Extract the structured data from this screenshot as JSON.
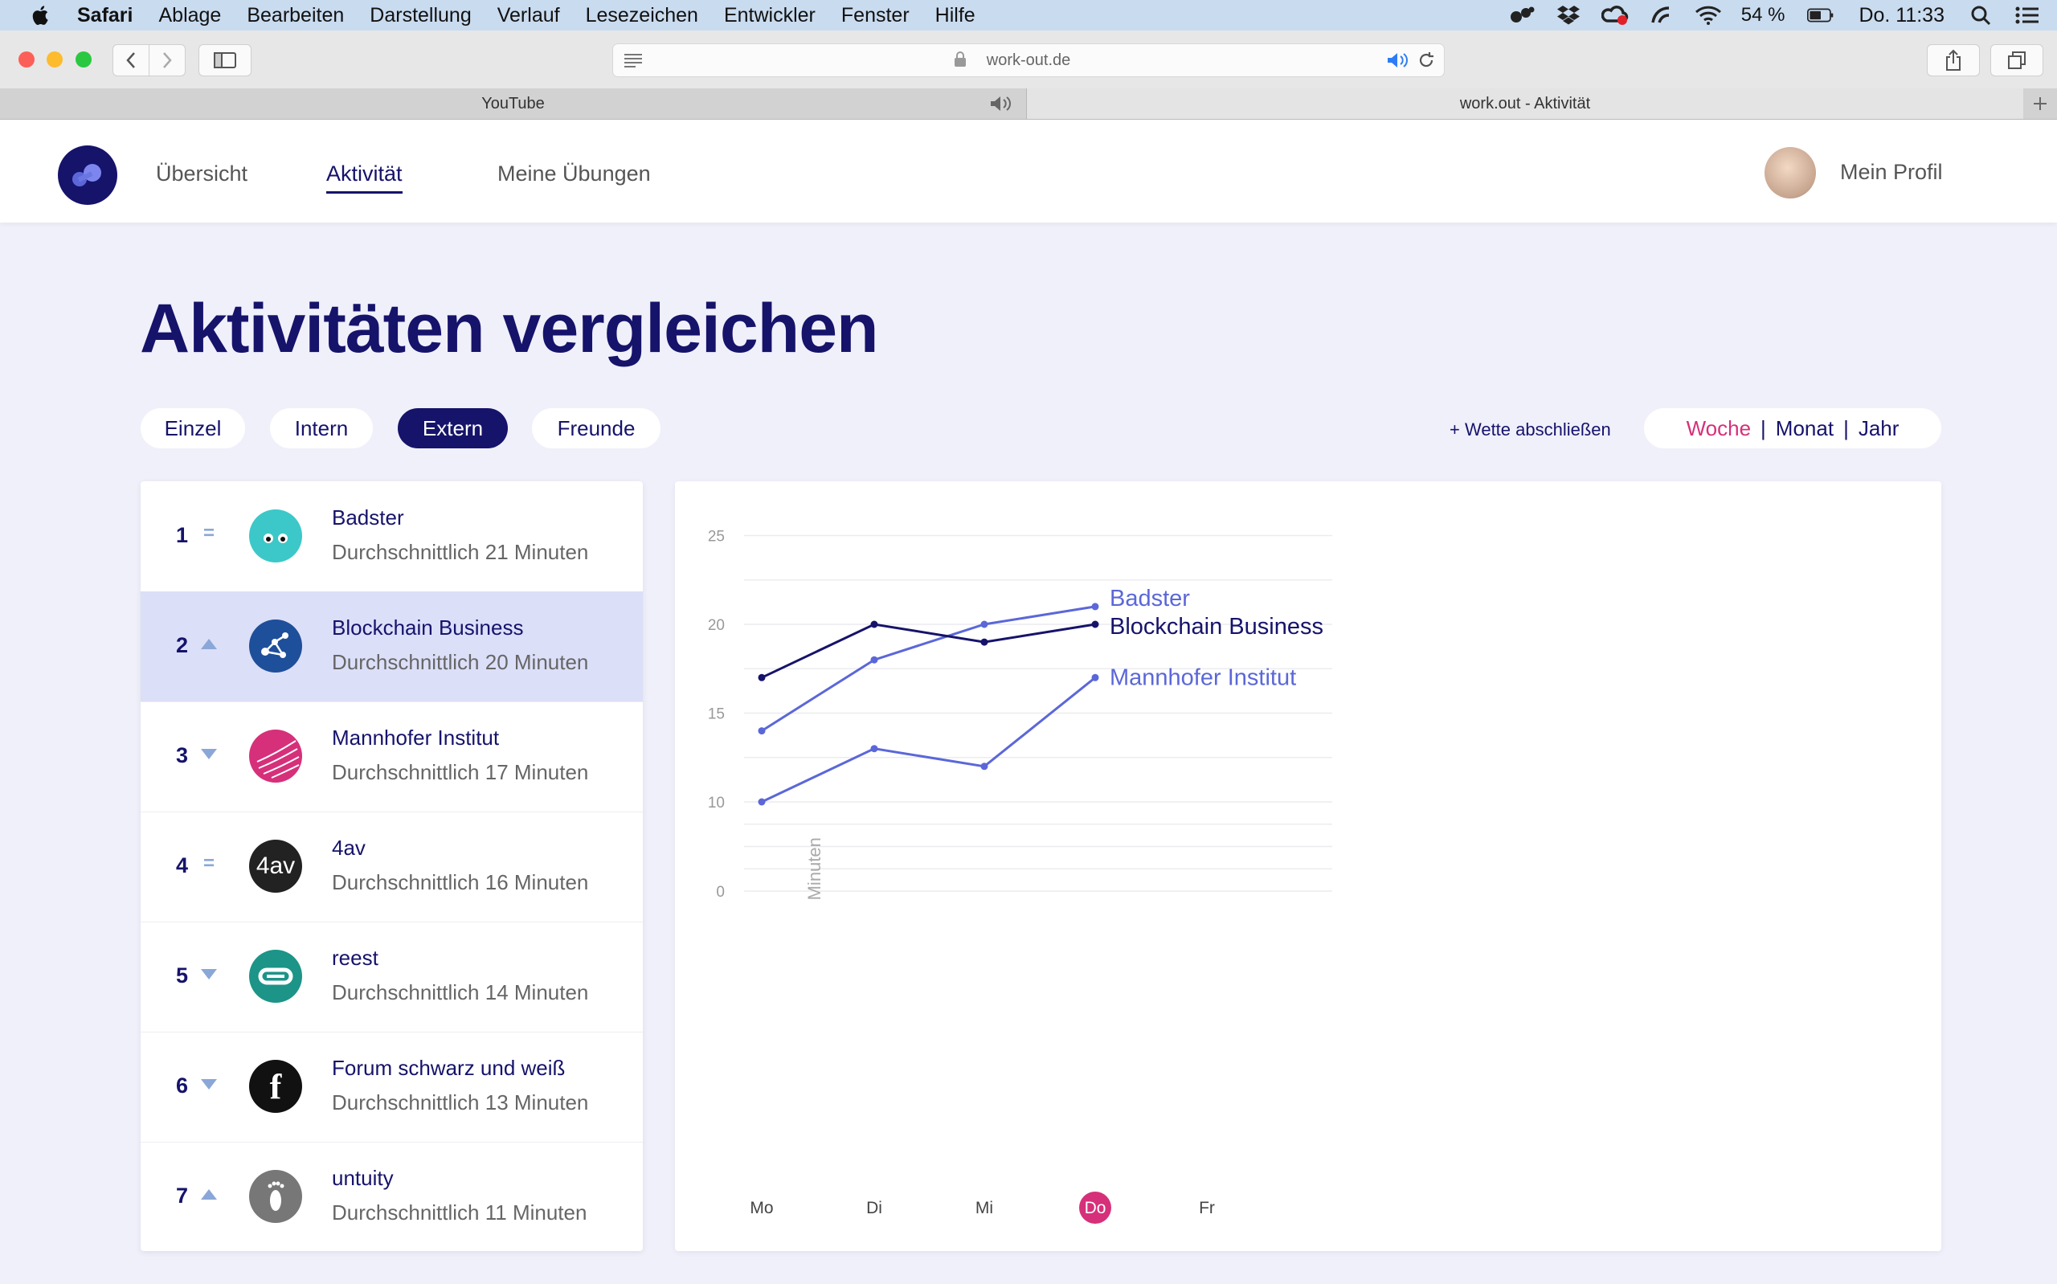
{
  "menubar": {
    "app": "Safari",
    "items": [
      "Ablage",
      "Bearbeiten",
      "Darstellung",
      "Verlauf",
      "Lesezeichen",
      "Entwickler",
      "Fenster",
      "Hilfe"
    ],
    "battery": "54 %",
    "clock": "Do. 11:33"
  },
  "browser": {
    "url": "work-out.de",
    "tabs": [
      "YouTube",
      "work.out - Aktivität"
    ]
  },
  "header": {
    "nav": [
      "Übersicht",
      "Aktivität",
      "Meine Übungen"
    ],
    "profile": "Mein Profil"
  },
  "page": {
    "title": "Aktivitäten vergleichen",
    "filters": [
      "Einzel",
      "Intern",
      "Extern",
      "Freunde"
    ],
    "wette": "+ Wette abschließen",
    "periods": [
      "Woche",
      "Monat",
      "Jahr"
    ],
    "period_separator": "|"
  },
  "ranking": [
    {
      "rank": "1",
      "trend": "same",
      "trend_symbol": "=",
      "name": "Badster",
      "avg": "Durchschnittlich 21 Minuten",
      "logo_color": "#3cc8c8",
      "logo": "eyes-logo-icon"
    },
    {
      "rank": "2",
      "trend": "up",
      "name": "Blockchain Business",
      "avg": "Durchschnittlich 20 Minuten",
      "logo_color": "#1e4f9a",
      "logo": "network-logo-icon"
    },
    {
      "rank": "3",
      "trend": "down",
      "name": "Mannhofer Institut",
      "avg": "Durchschnittlich 17 Minuten",
      "logo_color": "#d6307a",
      "logo": "sphere-logo-icon"
    },
    {
      "rank": "4",
      "trend": "same",
      "trend_symbol": "=",
      "name": "4av",
      "avg": "Durchschnittlich 16 Minuten",
      "logo_color": "#222222",
      "logo": "4av-logo-icon",
      "logo_text": "4av"
    },
    {
      "rank": "5",
      "trend": "down",
      "name": "reest",
      "avg": "Durchschnittlich 14 Minuten",
      "logo_color": "#1c9488",
      "logo": "infinity-logo-icon"
    },
    {
      "rank": "6",
      "trend": "down",
      "name": "Forum schwarz und weiß",
      "avg": "Durchschnittlich 13 Minuten",
      "logo_color": "#111111",
      "logo": "f-logo-icon",
      "logo_text": "f"
    },
    {
      "rank": "7",
      "trend": "up",
      "name": "untuity",
      "avg": "Durchschnittlich 11 Minuten",
      "logo_color": "#777777",
      "logo": "footprint-logo-icon"
    }
  ],
  "chart_data": {
    "type": "line",
    "categories": [
      "Mo",
      "Di",
      "Mi",
      "Do",
      "Fr"
    ],
    "highlight_category": "Do",
    "ylabel": "Minuten",
    "yticks": [
      0,
      10,
      15,
      20,
      25
    ],
    "ylim": [
      0,
      25
    ],
    "grid": true,
    "series": [
      {
        "name": "Badster",
        "values": [
          14,
          18,
          20,
          21,
          null
        ],
        "color": "#5b67d8"
      },
      {
        "name": "Blockchain Business",
        "values": [
          17,
          20,
          19,
          20,
          null
        ],
        "color": "#16136b"
      },
      {
        "name": "Mannhofer Institut",
        "values": [
          10,
          13,
          12,
          17,
          null
        ],
        "color": "#5b67d8"
      }
    ],
    "colors": {
      "accent": "#d6307a",
      "grid": "#ececf0",
      "tick": "#999999"
    }
  }
}
